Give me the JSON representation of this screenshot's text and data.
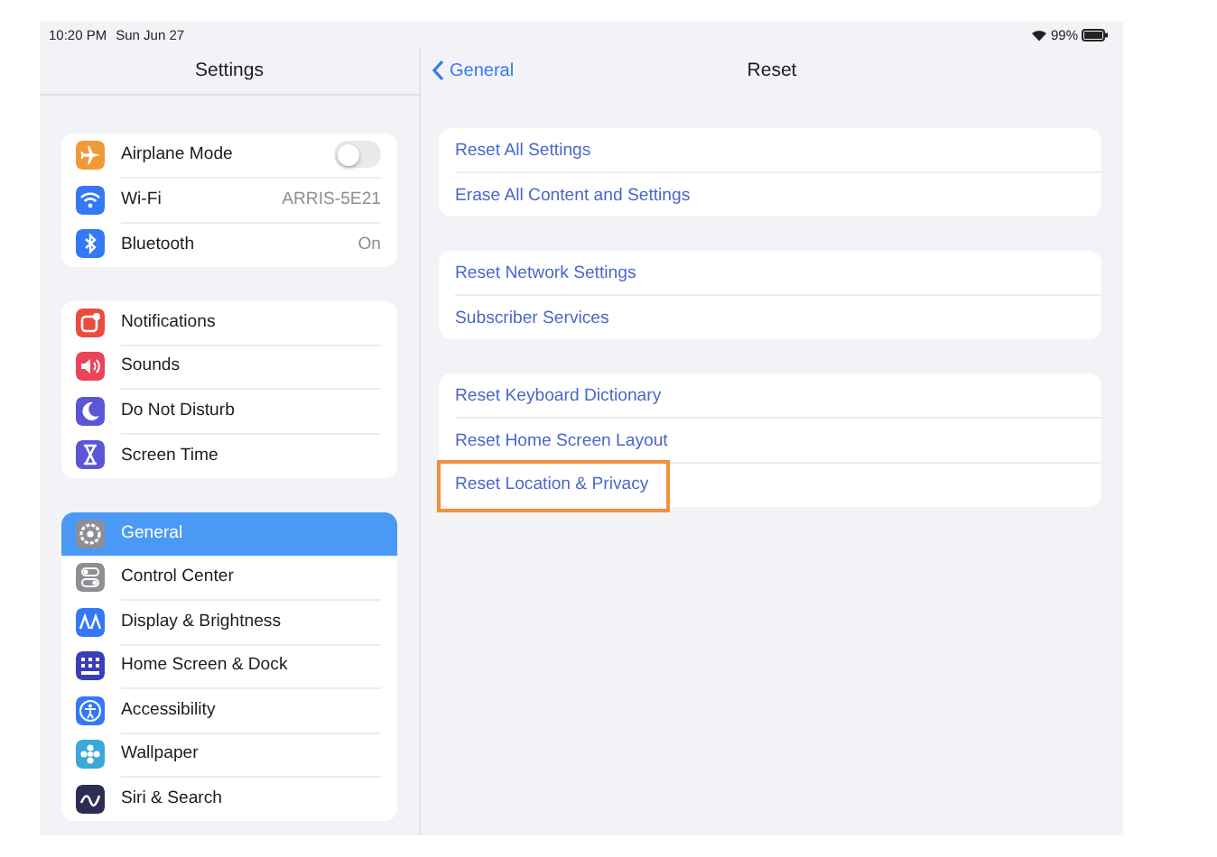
{
  "status_bar": {
    "time": "10:20 PM",
    "date": "Sun Jun 27",
    "battery": "99%"
  },
  "sidebar": {
    "title": "Settings",
    "groups": [
      {
        "items": [
          {
            "label": "Airplane Mode",
            "color": "#f09a37",
            "kind": "toggle",
            "on": false,
            "selected": false
          },
          {
            "label": "Wi-Fi",
            "color": "#3478f6",
            "kind": "value",
            "value": "ARRIS-5E21",
            "selected": false
          },
          {
            "label": "Bluetooth",
            "color": "#3478f6",
            "kind": "value",
            "value": "On",
            "selected": false
          }
        ]
      },
      {
        "items": [
          {
            "label": "Notifications",
            "color": "#eb4d3d",
            "kind": "plain",
            "selected": false
          },
          {
            "label": "Sounds",
            "color": "#eb445a",
            "kind": "plain",
            "selected": false
          },
          {
            "label": "Do Not Disturb",
            "color": "#5b56d6",
            "kind": "plain",
            "selected": false
          },
          {
            "label": "Screen Time",
            "color": "#5b56d6",
            "kind": "plain",
            "selected": false
          }
        ]
      },
      {
        "items": [
          {
            "label": "General",
            "color": "#8e8e93",
            "kind": "plain",
            "selected": true
          },
          {
            "label": "Control Center",
            "color": "#8e8e93",
            "kind": "plain",
            "selected": false
          },
          {
            "label": "Display & Brightness",
            "color": "#3478f6",
            "kind": "plain",
            "selected": false
          },
          {
            "label": "Home Screen & Dock",
            "color": "#3a3fb8",
            "kind": "plain",
            "selected": false
          },
          {
            "label": "Accessibility",
            "color": "#3478f6",
            "kind": "plain",
            "selected": false
          },
          {
            "label": "Wallpaper",
            "color": "#3aa8d8",
            "kind": "plain",
            "selected": false
          },
          {
            "label": "Siri & Search",
            "color": "#2c2c54",
            "kind": "plain",
            "selected": false
          }
        ]
      }
    ]
  },
  "detail": {
    "back": "General",
    "title": "Reset",
    "groups": [
      {
        "items": [
          {
            "label": "Reset All Settings",
            "highlighted": false
          },
          {
            "label": "Erase All Content and Settings",
            "highlighted": false
          }
        ]
      },
      {
        "items": [
          {
            "label": "Reset Network Settings",
            "highlighted": false
          },
          {
            "label": "Subscriber Services",
            "highlighted": false
          }
        ]
      },
      {
        "items": [
          {
            "label": "Reset Keyboard Dictionary",
            "highlighted": false
          },
          {
            "label": "Reset Home Screen Layout",
            "highlighted": false
          },
          {
            "label": "Reset Location & Privacy",
            "highlighted": true
          }
        ]
      }
    ]
  }
}
